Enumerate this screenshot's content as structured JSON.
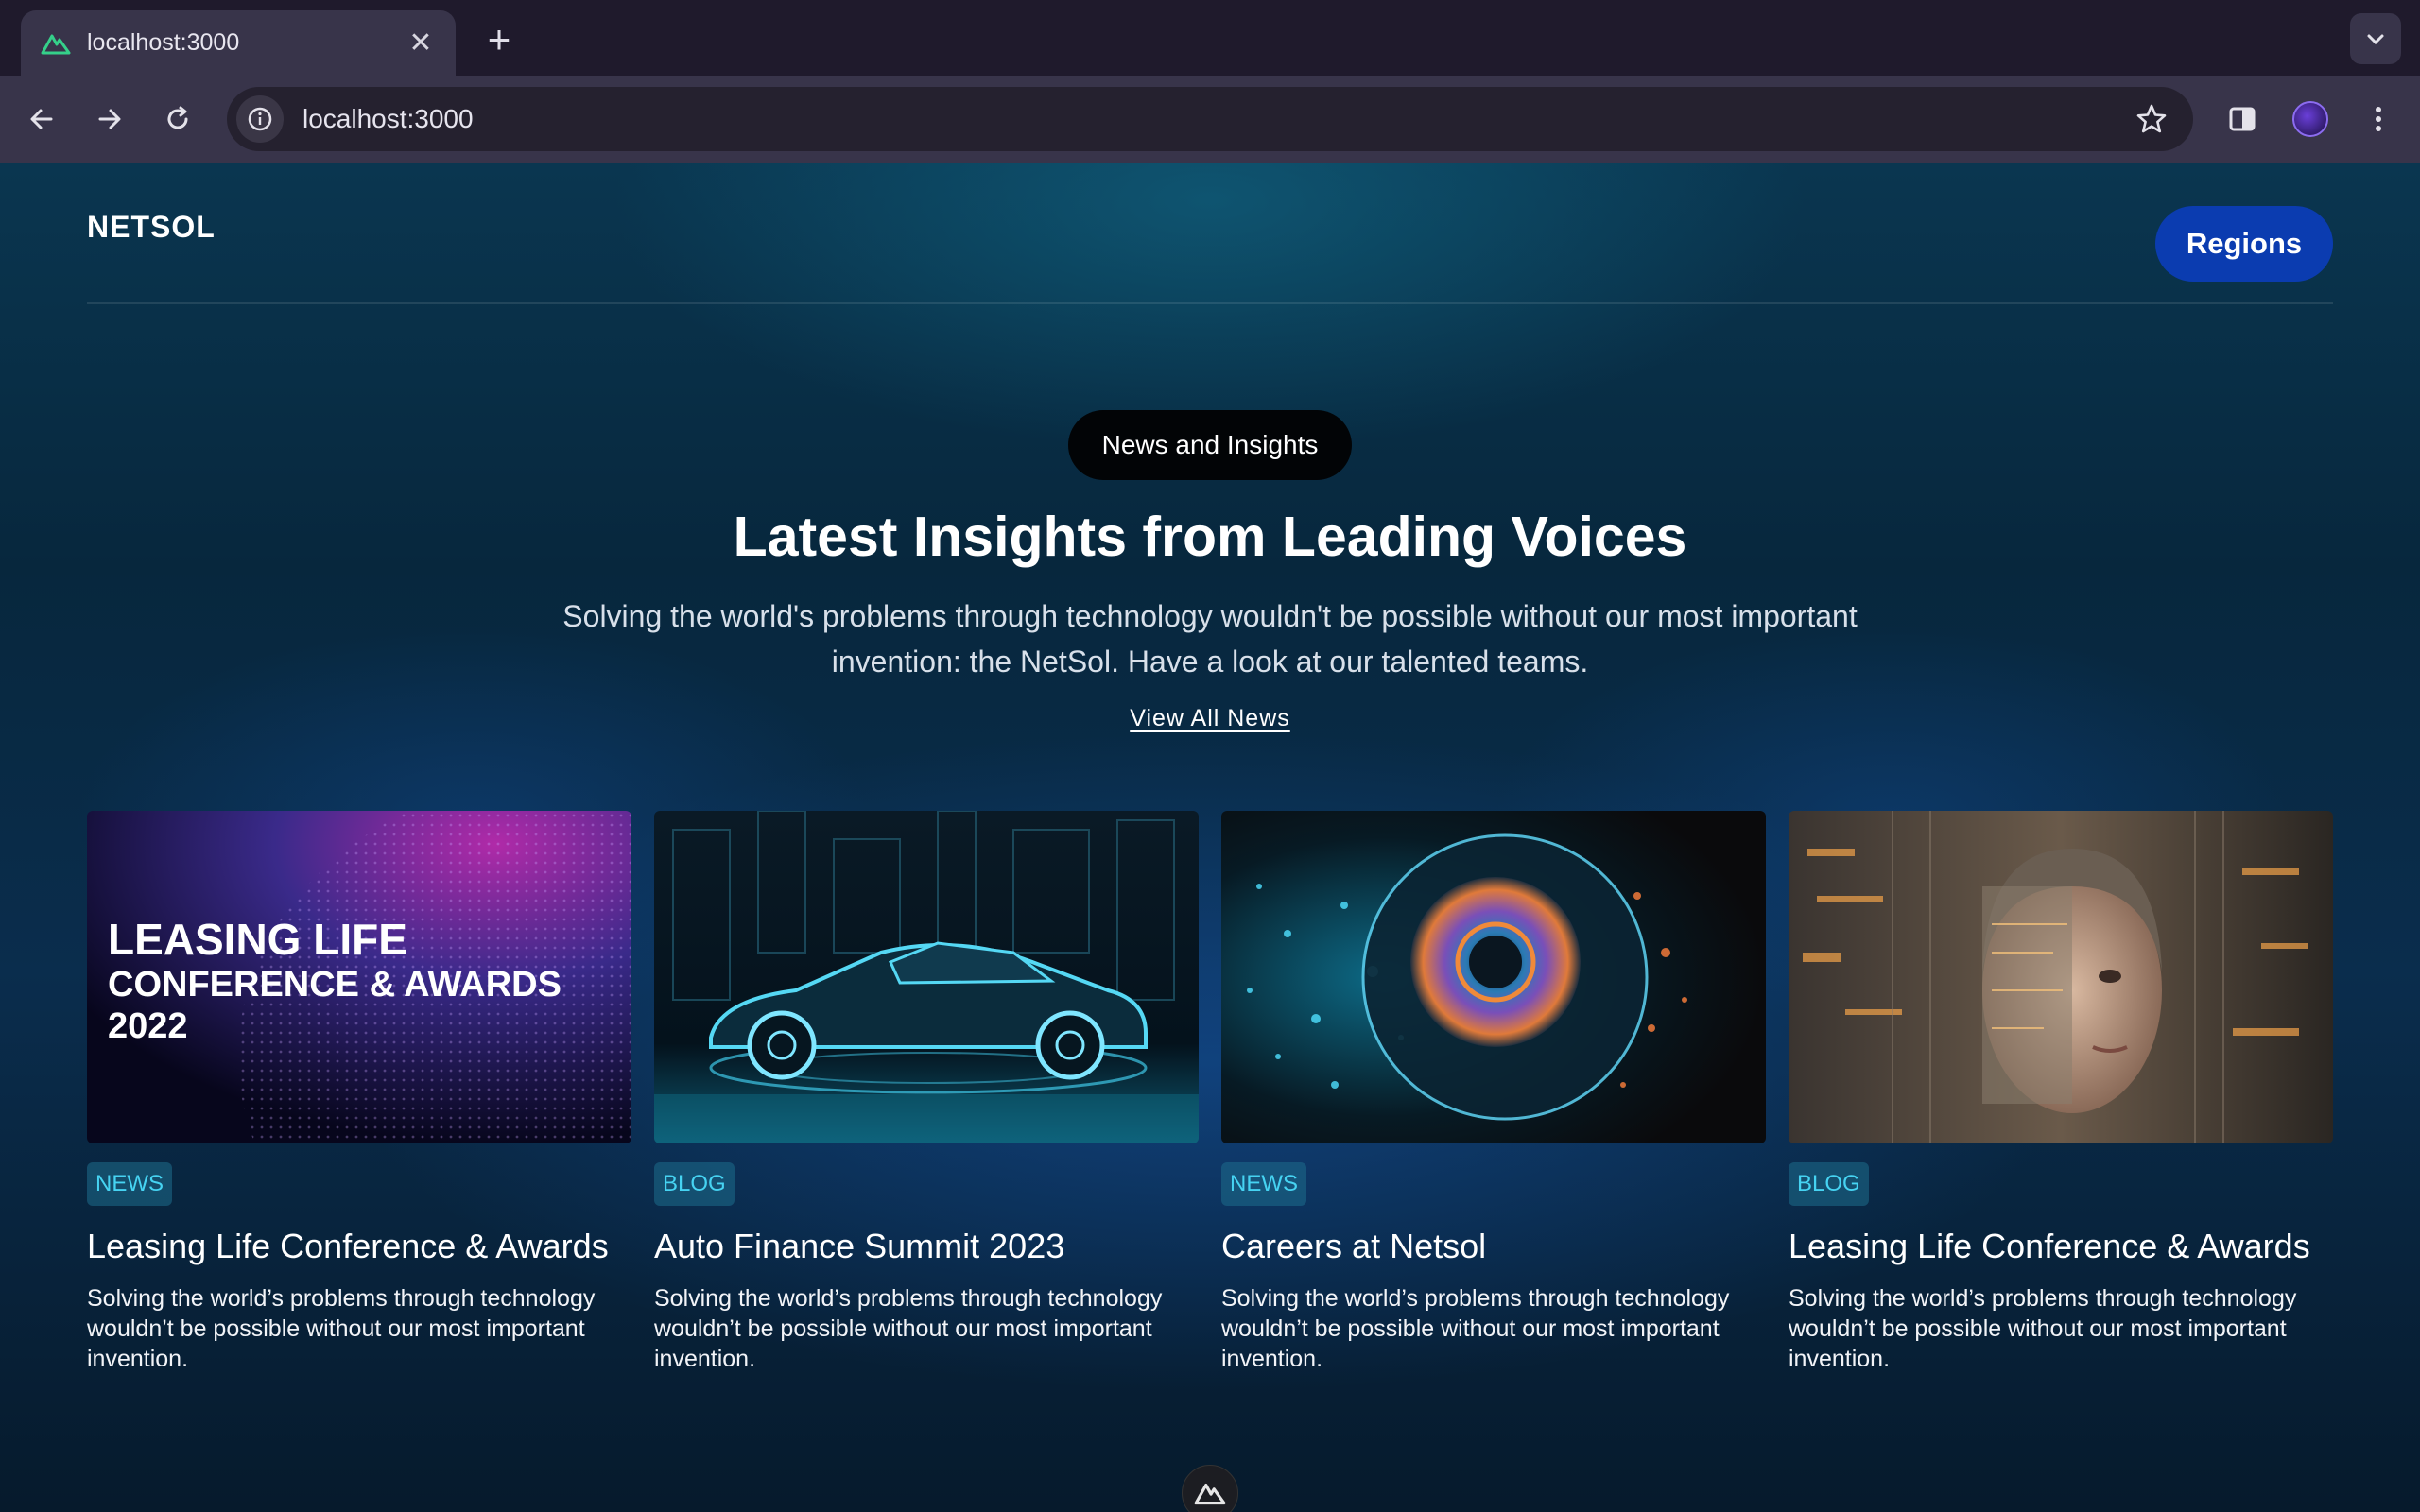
{
  "browser": {
    "tab_title": "localhost:3000",
    "url": "localhost:3000"
  },
  "header": {
    "logo": "NETSOL",
    "regions_label": "Regions"
  },
  "hero": {
    "eyebrow": "News and Insights",
    "headline": "Latest Insights from Leading Voices",
    "subtext": "Solving the world's problems through technology wouldn't be possible without our most important invention: the NetSol. Have a look at our talented teams.",
    "view_all": "View All News"
  },
  "cards": [
    {
      "badge": "NEWS",
      "title": "Leasing Life Conference & Awards",
      "desc": "Solving the world’s problems through technology wouldn’t be possible without our most important invention.",
      "image_text": [
        "LEASING LIFE",
        "CONFERENCE & AWARDS",
        "2022"
      ]
    },
    {
      "badge": "BLOG",
      "title": "Auto Finance Summit 2023",
      "desc": "Solving the world’s problems through technology wouldn’t be possible without our most important invention."
    },
    {
      "badge": "NEWS",
      "title": "Careers at Netsol",
      "desc": "Solving the world’s problems through technology wouldn’t be possible without our most important invention."
    },
    {
      "badge": "BLOG",
      "title": "Leasing Life Conference & Awards",
      "desc": "Solving the world’s problems through technology wouldn’t be possible without our most important invention."
    }
  ],
  "colors": {
    "accent_button": "#0b3cb0",
    "badge_text": "#46d3f2",
    "page_bg": "#07273d"
  },
  "icons": [
    "nuxt-logo-icon",
    "close-icon",
    "plus-icon",
    "chevron-down-icon",
    "back-arrow-icon",
    "forward-arrow-icon",
    "reload-icon",
    "site-info-icon",
    "star-icon",
    "side-panel-icon",
    "profile-avatar",
    "kebab-menu-icon"
  ]
}
